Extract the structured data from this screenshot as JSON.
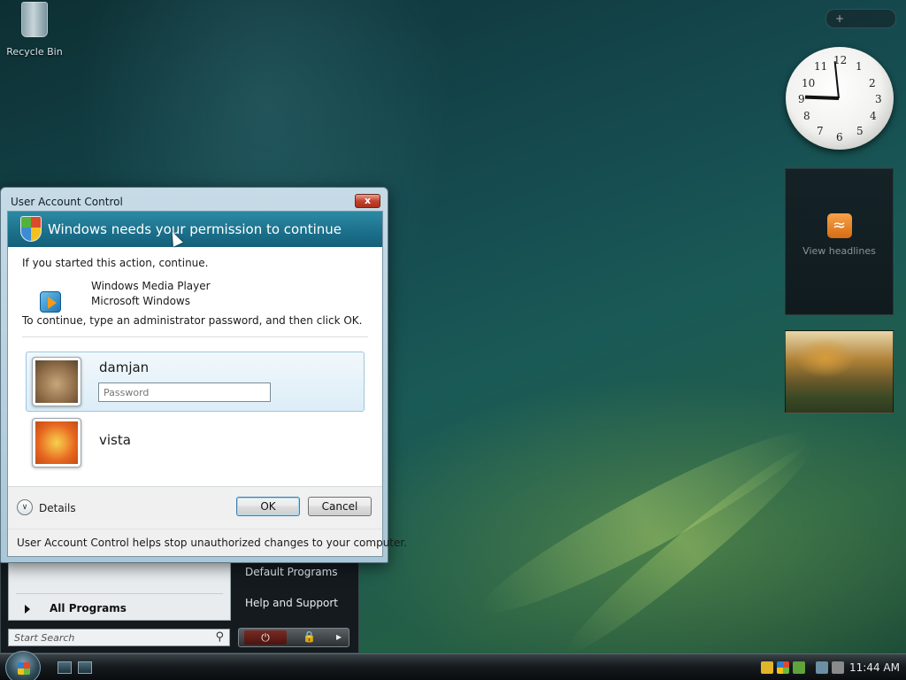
{
  "desktop": {
    "recycle_bin_label": "Recycle Bin"
  },
  "gadgets": {
    "clock_numbers": [
      "12",
      "1",
      "2",
      "3",
      "4",
      "5",
      "6",
      "7",
      "8",
      "9",
      "10",
      "11"
    ],
    "feed_label": "View headlines",
    "toolbar_add": "+"
  },
  "dialog": {
    "title": "User Account Control",
    "close_glyph": "x",
    "banner": "Windows needs your permission to continue",
    "intro": "If you started this action, continue.",
    "program_name": "Windows Media Player",
    "publisher": "Microsoft Windows",
    "instruction": "To continue, type an administrator password, and then click OK.",
    "users": [
      {
        "name": "damjan",
        "password_placeholder": "Password"
      },
      {
        "name": "vista"
      }
    ],
    "details_label": "Details",
    "ok_label": "OK",
    "cancel_label": "Cancel",
    "footer_note": "User Account Control helps stop unauthorized changes to your computer."
  },
  "start_menu": {
    "all_programs": "All Programs",
    "search_placeholder": "Start Search",
    "links": [
      "Default Programs",
      "Help and Support"
    ]
  },
  "taskbar": {
    "time": "11:44 AM"
  },
  "colors": {
    "banner": "#1b6f8a",
    "close_button": "#c7422b",
    "default_button_border": "#3c7fb1",
    "selected_user_border": "#9cc6df"
  }
}
